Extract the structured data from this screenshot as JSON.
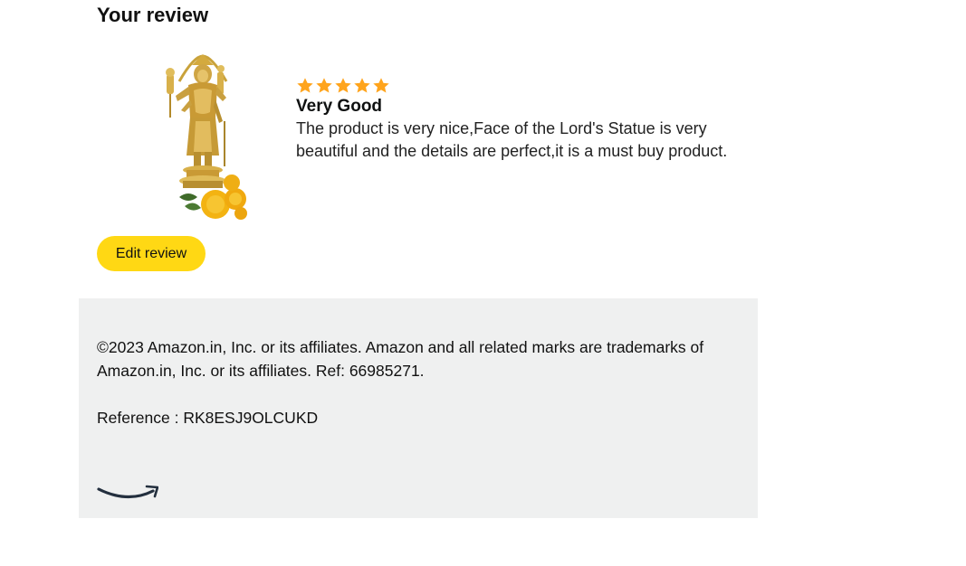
{
  "review": {
    "heading": "Your review",
    "rating": 5,
    "rating_max": 5,
    "title": "Very Good",
    "text": "The product is very nice,Face of the Lord's Statue is very beautiful and the details are perfect,it is a must buy product.",
    "edit_label": "Edit review",
    "star_color": "#ffa41c",
    "button_color": "#ffd814"
  },
  "footer": {
    "copyright": "©2023 Amazon.in, Inc. or its affiliates. Amazon and all related marks are trademarks of Amazon.in, Inc. or its affiliates. Ref: 66985271.",
    "reference": "Reference : RK8ESJ9OLCUKD",
    "background": "#eff0f0",
    "logo_icon": "amazon-smile-logo"
  }
}
